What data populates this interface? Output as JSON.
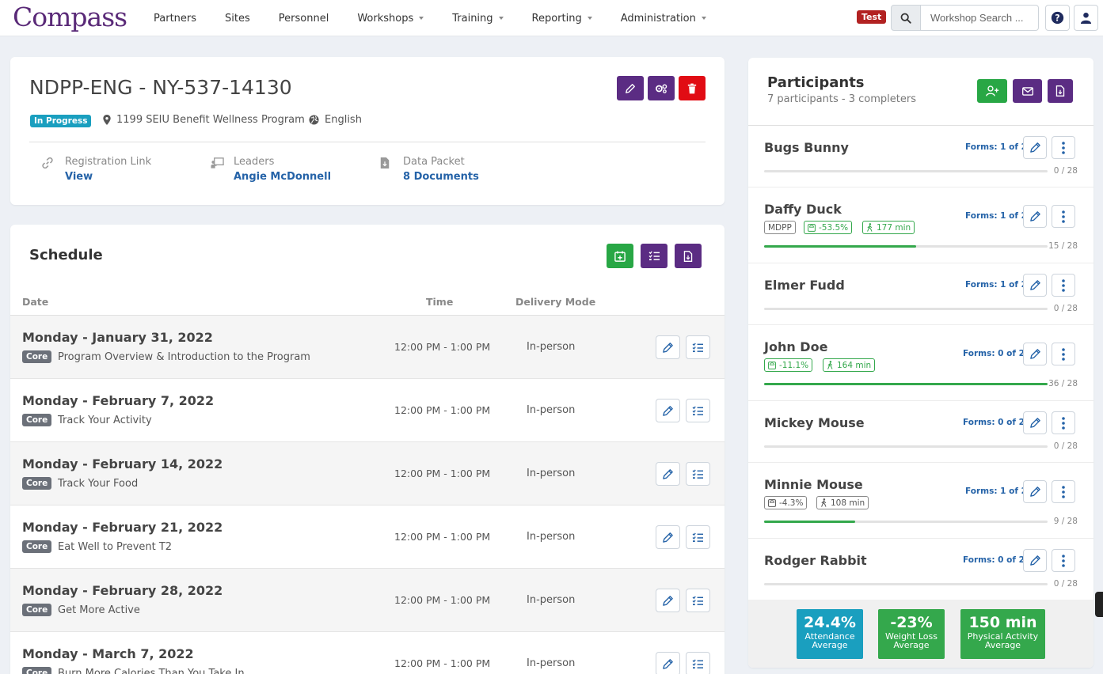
{
  "brand": {
    "name": "Compass"
  },
  "nav": {
    "items": [
      {
        "label": "Partners",
        "dropdown": false
      },
      {
        "label": "Sites",
        "dropdown": false
      },
      {
        "label": "Personnel",
        "dropdown": false
      },
      {
        "label": "Workshops",
        "dropdown": true
      },
      {
        "label": "Training",
        "dropdown": true
      },
      {
        "label": "Reporting",
        "dropdown": true
      },
      {
        "label": "Administration",
        "dropdown": true
      }
    ],
    "env_badge": "Test",
    "search_placeholder": "Workshop Search ..."
  },
  "workshop": {
    "title": "NDPP-ENG - NY-537-14130",
    "status": "In Progress",
    "location": "1199 SEIU Benefit Wellness Program",
    "language": "English",
    "registration": {
      "label": "Registration Link",
      "value": "View"
    },
    "leaders": {
      "label": "Leaders",
      "value": "Angie McDonnell"
    },
    "data_packet": {
      "label": "Data Packet",
      "value": "8 Documents"
    }
  },
  "schedule": {
    "title": "Schedule",
    "columns": {
      "date": "Date",
      "time": "Time",
      "mode": "Delivery Mode"
    },
    "sessions": [
      {
        "date": "Monday - January 31, 2022",
        "type": "Core",
        "topic": "Program Overview & Introduction to the Program",
        "time": "12:00 PM - 1:00 PM",
        "mode": "In-person"
      },
      {
        "date": "Monday - February 7, 2022",
        "type": "Core",
        "topic": "Track Your Activity",
        "time": "12:00 PM - 1:00 PM",
        "mode": "In-person"
      },
      {
        "date": "Monday - February 14, 2022",
        "type": "Core",
        "topic": "Track Your Food",
        "time": "12:00 PM - 1:00 PM",
        "mode": "In-person"
      },
      {
        "date": "Monday - February 21, 2022",
        "type": "Core",
        "topic": "Eat Well to Prevent T2",
        "time": "12:00 PM - 1:00 PM",
        "mode": "In-person"
      },
      {
        "date": "Monday - February 28, 2022",
        "type": "Core",
        "topic": "Get More Active",
        "time": "12:00 PM - 1:00 PM",
        "mode": "In-person"
      },
      {
        "date": "Monday - March 7, 2022",
        "type": "Core",
        "topic": "Burn More Calories Than You Take In",
        "time": "12:00 PM - 1:00 PM",
        "mode": "In-person"
      }
    ]
  },
  "participants": {
    "title": "Participants",
    "subtitle": "7 participants - 3 completers",
    "list": [
      {
        "name": "Bugs Bunny",
        "forms": "Forms: 1 of 2",
        "progress": "0 / 28",
        "fraction": 0,
        "tags": []
      },
      {
        "name": "Daffy Duck",
        "forms": "Forms: 1 of 2",
        "progress": "15 / 28",
        "fraction": 0.536,
        "tags": [
          {
            "kind": "plain",
            "text": "MDPP"
          },
          {
            "kind": "weight",
            "text": "-53.5%",
            "green": true
          },
          {
            "kind": "activity",
            "text": "177 min",
            "green": true
          }
        ]
      },
      {
        "name": "Elmer Fudd",
        "forms": "Forms: 1 of 2",
        "progress": "0 / 28",
        "fraction": 0,
        "tags": []
      },
      {
        "name": "John Doe",
        "forms": "Forms: 0 of 2",
        "progress": "36 / 28",
        "fraction": 1,
        "tags": [
          {
            "kind": "weight",
            "text": "-11.1%",
            "green": true
          },
          {
            "kind": "activity",
            "text": "164 min",
            "green": true
          }
        ]
      },
      {
        "name": "Mickey Mouse",
        "forms": "Forms: 0 of 2",
        "progress": "0 / 28",
        "fraction": 0,
        "tags": []
      },
      {
        "name": "Minnie Mouse",
        "forms": "Forms: 1 of 2",
        "progress": "9 / 28",
        "fraction": 0.321,
        "tags": [
          {
            "kind": "weight",
            "text": "-4.3%",
            "green": false
          },
          {
            "kind": "activity",
            "text": "108 min",
            "green": false
          }
        ]
      },
      {
        "name": "Rodger Rabbit",
        "forms": "Forms: 0 of 2",
        "progress": "0 / 28",
        "fraction": 0,
        "tags": []
      }
    ],
    "stats": [
      {
        "value": "24.4%",
        "label": "Attendance Average",
        "color": "#1a9fbf"
      },
      {
        "value": "-23%",
        "label": "Weight Loss Average",
        "color": "#34a84c"
      },
      {
        "value": "150 min",
        "label": "Physical Activity Average",
        "color": "#34a84c"
      }
    ]
  },
  "colors": {
    "brand": "#5a2a78",
    "purple_btn": "#5b2c83",
    "danger": "#e10c14",
    "success": "#28a745",
    "info": "#1a9fbf",
    "link": "#2563a8"
  }
}
